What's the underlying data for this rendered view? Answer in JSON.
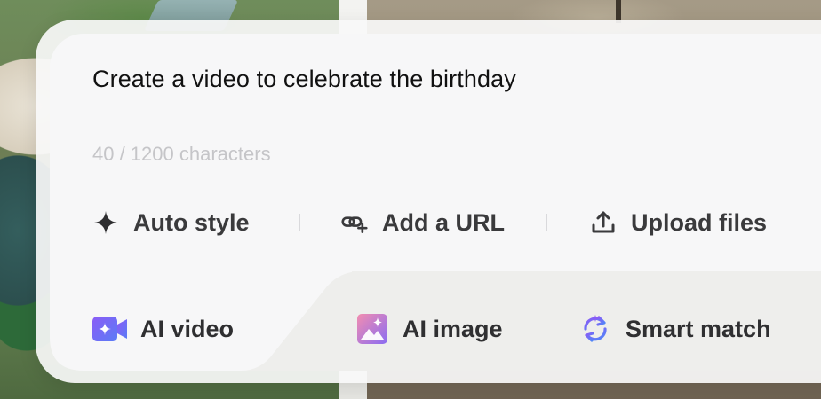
{
  "prompt": {
    "text": "Create a video to celebrate the birthday",
    "char_count": "40 / 1200 characters"
  },
  "tools": [
    {
      "label": "Auto style",
      "icon": "sparkle-icon"
    },
    {
      "label": "Add a URL",
      "icon": "link-add-icon"
    },
    {
      "label": "Upload files",
      "icon": "upload-icon"
    }
  ],
  "tabs": [
    {
      "label": "AI video",
      "icon": "video-sparkle-icon",
      "active": true
    },
    {
      "label": "AI image",
      "icon": "image-icon",
      "active": false
    },
    {
      "label": "Smart match",
      "icon": "refresh-cycle-icon",
      "active": false
    }
  ],
  "colors": {
    "accent_gradient_start": "#7b5cf6",
    "accent_gradient_end": "#4e7cf7",
    "image_gradient_start": "#f08cb2",
    "image_gradient_end": "#8c6cf2",
    "text_primary": "#111111",
    "text_muted": "#c5c5c8"
  }
}
